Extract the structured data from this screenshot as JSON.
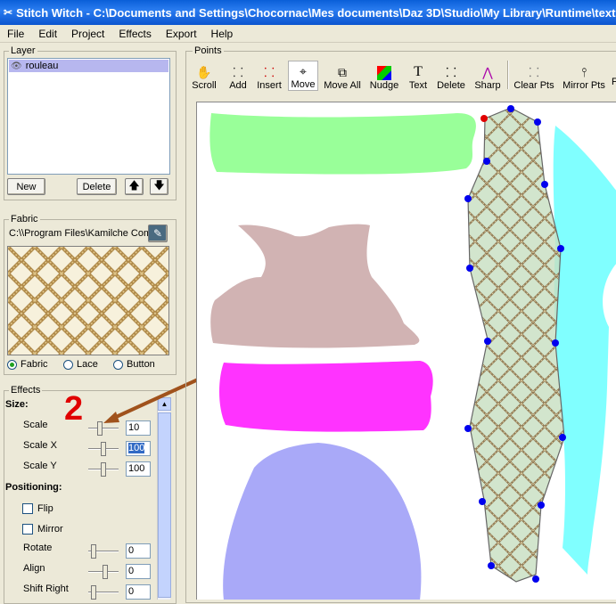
{
  "window": {
    "title": "Stitch Witch - C:\\Documents and Settings\\Chocornac\\Mes documents\\Daz 3D\\Studio\\My Library\\Runtime\\textures"
  },
  "menu": [
    "File",
    "Edit",
    "Project",
    "Effects",
    "Export",
    "Help"
  ],
  "layer": {
    "group_label": "Layer",
    "items": [
      "rouleau"
    ],
    "new_label": "New",
    "delete_label": "Delete"
  },
  "fabric": {
    "group_label": "Fabric",
    "path": "C:\\\\Program Files\\Kamilche Computing",
    "options": [
      "Fabric",
      "Lace",
      "Button"
    ],
    "selected": "Fabric"
  },
  "effects": {
    "group_label": "Effects",
    "size_heading": "Size:",
    "annotation_number": "2",
    "scale": {
      "label": "Scale",
      "value": "10"
    },
    "scale_x": {
      "label": "Scale X",
      "value": "100"
    },
    "scale_y": {
      "label": "Scale Y",
      "value": "100"
    },
    "positioning_heading": "Positioning:",
    "flip_label": "Flip",
    "mirror_label": "Mirror",
    "rotate": {
      "label": "Rotate",
      "value": "0"
    },
    "align": {
      "label": "Align",
      "value": "0"
    },
    "shift_right": {
      "label": "Shift Right",
      "value": "0"
    }
  },
  "points": {
    "group_label": "Points",
    "tools": [
      "Scroll",
      "Add",
      "Insert",
      "Move",
      "Move All",
      "Nudge",
      "Text",
      "Delete",
      "Sharp",
      "Clear Pts",
      "Mirror Pts"
    ],
    "active_tool": "Move"
  },
  "colors": {
    "green_piece": "#99ff99",
    "tan_piece": "#d1b3b3",
    "magenta_piece": "#ff33ff",
    "lavender_piece": "#a9a9f8",
    "cyan_piece": "#80ffff",
    "selected_piece": "#c7dec0",
    "control_point": "#0000ee",
    "annotation": "#e00000"
  }
}
